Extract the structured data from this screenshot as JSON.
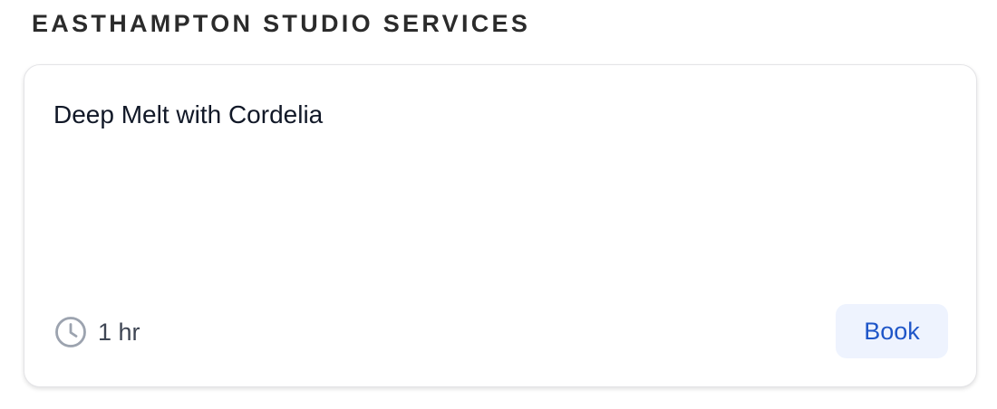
{
  "section": {
    "title": "EASTHAMPTON STUDIO SERVICES"
  },
  "service": {
    "name": "Deep Melt with Cordelia",
    "duration": "1 hr",
    "duration_icon": "clock-icon",
    "book_label": "Book"
  },
  "colors": {
    "accent": "#1f56c8",
    "button_bg": "#eef3fe",
    "title_text": "#2b2b2b",
    "icon": "#9ca3af"
  }
}
